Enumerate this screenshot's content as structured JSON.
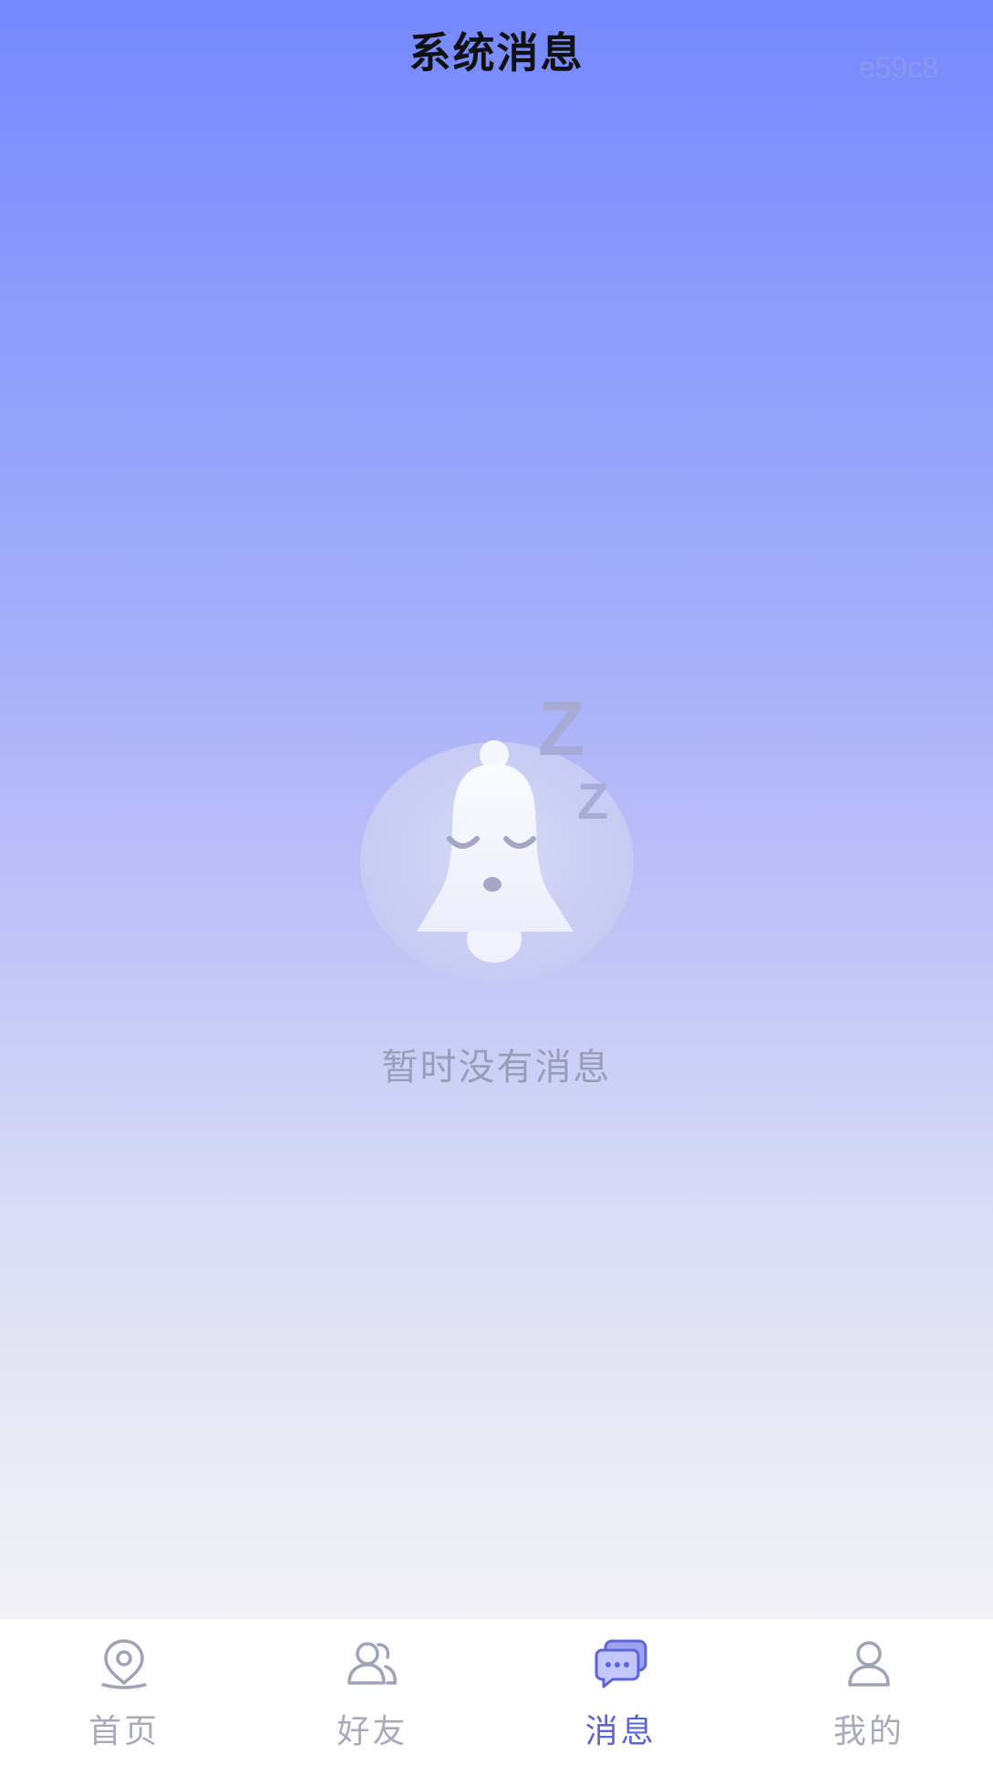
{
  "header": {
    "title": "系统消息",
    "corner_code": "e59c8"
  },
  "empty_state": {
    "message": "暂时没有消息",
    "icon": "sleeping-bell-icon",
    "zz_large": "Z",
    "zz_small": "Z"
  },
  "tabbar": {
    "tabs": [
      {
        "label": "首页",
        "icon": "location-pin-icon",
        "active": false
      },
      {
        "label": "好友",
        "icon": "friends-icon",
        "active": false
      },
      {
        "label": "消息",
        "icon": "message-bubbles-icon",
        "active": true
      },
      {
        "label": "我的",
        "icon": "person-icon",
        "active": false
      }
    ]
  },
  "colors": {
    "gradient_top": "#7588fd",
    "gradient_bottom": "#f1f1f6",
    "active_tab": "#5b64d9",
    "inactive_tab": "#a7aabd",
    "empty_text": "#9a9db8"
  }
}
